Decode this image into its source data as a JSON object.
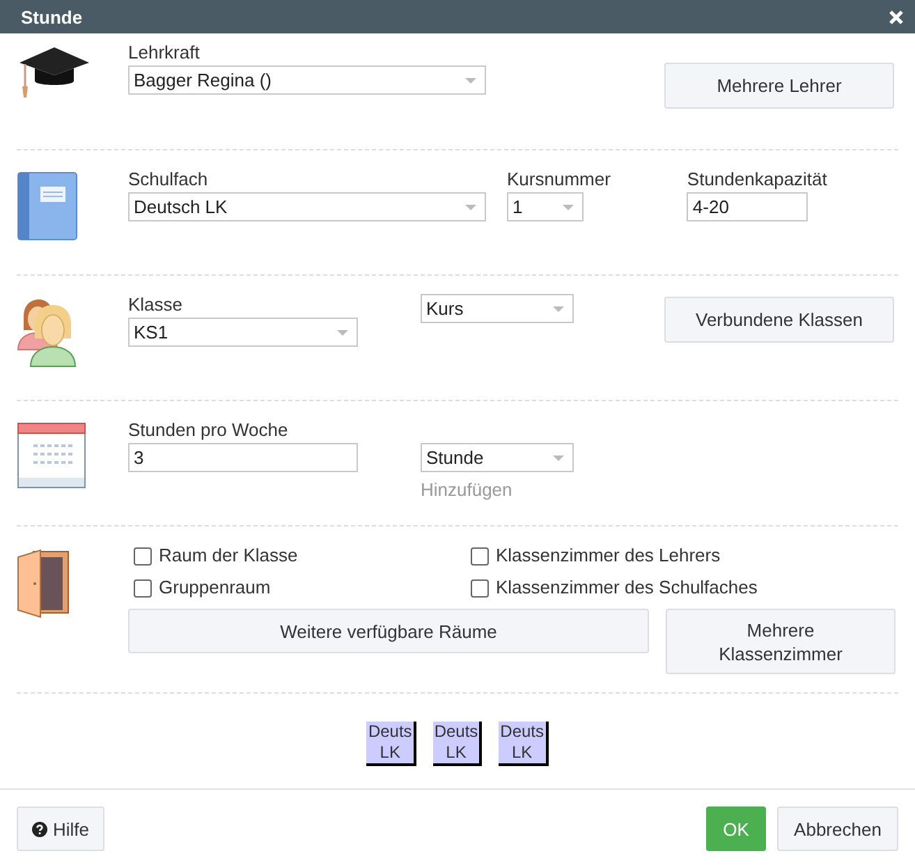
{
  "window": {
    "title": "Stunde"
  },
  "teacher": {
    "label": "Lehrkraft",
    "value": "Bagger Regina ()",
    "button": "Mehrere Lehrer"
  },
  "subject": {
    "label": "Schulfach",
    "value": "Deutsch LK",
    "course_label": "Kursnummer",
    "course_value": "1",
    "capacity_label": "Stundenkapazität",
    "capacity_value": "4-20"
  },
  "class": {
    "label": "Klasse",
    "value": "KS1",
    "type_value": "Kurs",
    "button": "Verbundene Klassen"
  },
  "hours": {
    "label": "Stunden pro Woche",
    "value": "3",
    "unit_value": "Stunde",
    "add_link": "Hinzufügen"
  },
  "rooms": {
    "options": [
      {
        "label": "Raum der Klasse",
        "checked": false
      },
      {
        "label": "Klassenzimmer des Lehrers",
        "checked": false
      },
      {
        "label": "Gruppenraum",
        "checked": false
      },
      {
        "label": "Klassenzimmer des Schulfaches",
        "checked": false
      }
    ],
    "buttons": [
      "Weitere verfügbare Räume",
      "Mehrere Klassenzimmer"
    ]
  },
  "chips": [
    {
      "label": "Deuts LK"
    },
    {
      "label": "Deuts LK"
    },
    {
      "label": "Deuts LK"
    }
  ],
  "footer": {
    "help": "Hilfe",
    "ok": "OK",
    "cancel": "Abbrechen"
  }
}
